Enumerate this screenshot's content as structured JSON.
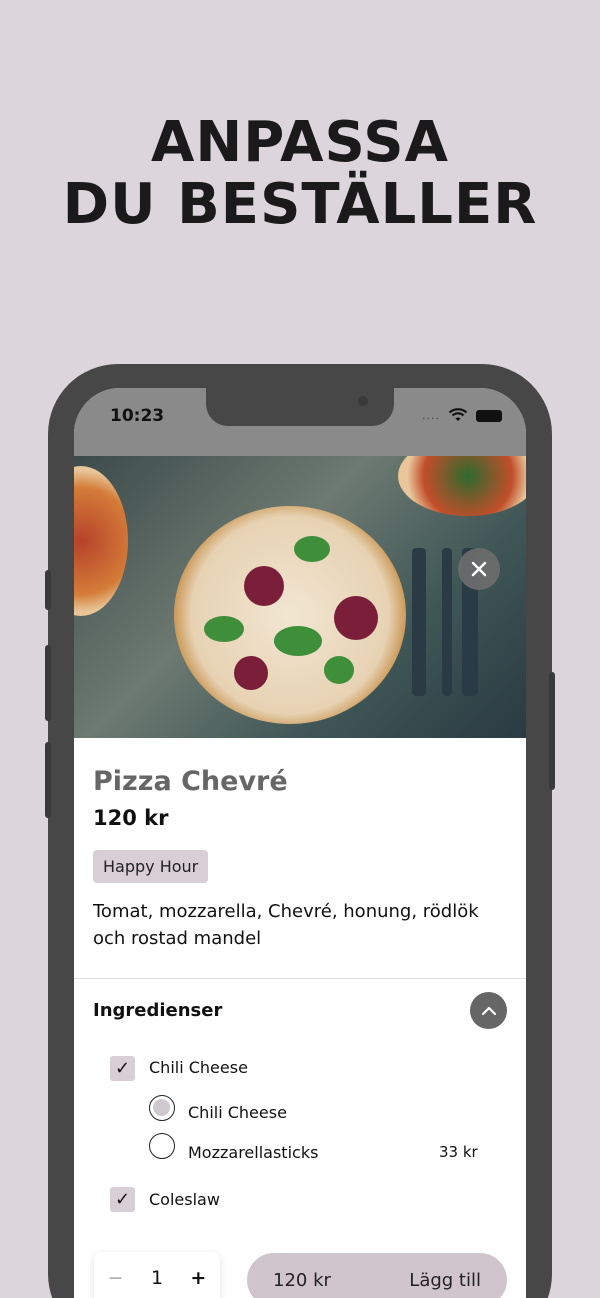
{
  "headline": {
    "line1": "ANPASSA",
    "line2": "DU BESTÄLLER"
  },
  "status_bar": {
    "time": "10:23",
    "signal_dots": "....",
    "wifi_icon": "wifi-icon",
    "battery_icon": "battery-icon"
  },
  "product": {
    "name": "Pizza Chevré",
    "price": "120 kr",
    "badge": "Happy Hour",
    "description": "Tomat, mozzarella, Chevré, honung, rödlök och rostad mandel"
  },
  "ingredients": {
    "title": "Ingredienser",
    "groups": [
      {
        "label": "Chili Cheese",
        "checked": true,
        "options": [
          {
            "label": "Chili Cheese",
            "selected": true,
            "price": ""
          },
          {
            "label": "Mozzarellasticks",
            "selected": false,
            "price": "33 kr"
          }
        ]
      },
      {
        "label": "Coleslaw",
        "checked": true,
        "options": []
      }
    ]
  },
  "footer": {
    "quantity": "1",
    "minus": "−",
    "plus": "+",
    "total": "120 kr",
    "add_label": "Lägg till"
  },
  "colors": {
    "background": "#dcd5dc",
    "accent": "#d0c5cd",
    "phone": "#474747"
  }
}
